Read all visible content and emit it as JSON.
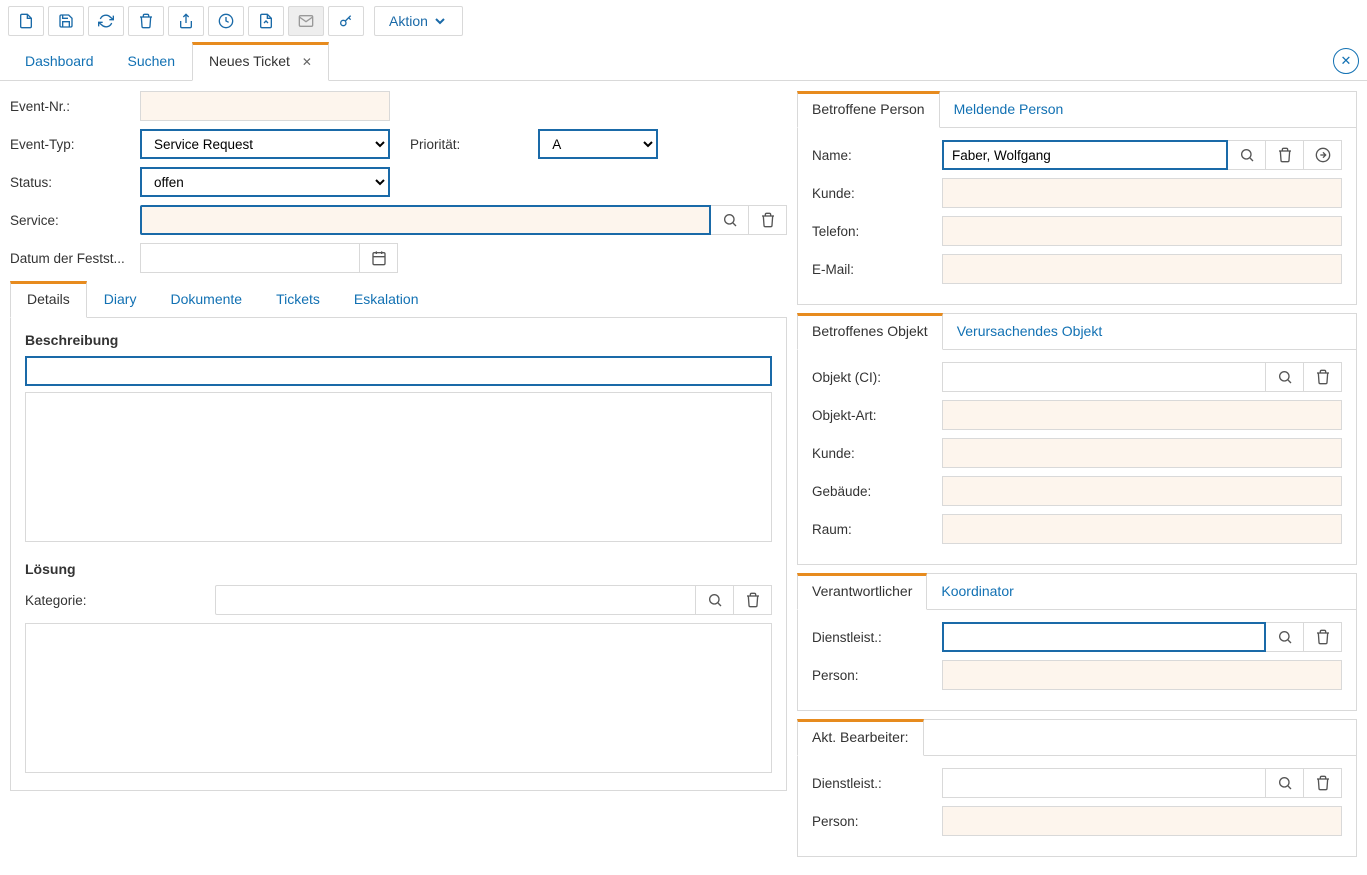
{
  "toolbar": {
    "action_label": "Aktion"
  },
  "main_tabs": {
    "items": [
      {
        "label": "Dashboard",
        "active": false,
        "closable": false
      },
      {
        "label": "Suchen",
        "active": false,
        "closable": false
      },
      {
        "label": "Neues Ticket",
        "active": true,
        "closable": true
      }
    ]
  },
  "form": {
    "event_nr_label": "Event-Nr.:",
    "event_nr_value": "",
    "event_type_label": "Event-Typ:",
    "event_type_value": "Service Request",
    "priority_label": "Priorität:",
    "priority_value": "A",
    "status_label": "Status:",
    "status_value": "offen",
    "service_label": "Service:",
    "service_value": "",
    "date_label": "Datum der Festst...",
    "date_value": ""
  },
  "detail_tabs": [
    "Details",
    "Diary",
    "Dokumente",
    "Tickets",
    "Eskalation"
  ],
  "details": {
    "description_heading": "Beschreibung",
    "description_title": "",
    "description_body": "",
    "solution_heading": "Lösung",
    "category_label": "Kategorie:",
    "category_value": "",
    "solution_body": ""
  },
  "person_panel": {
    "tabs": [
      "Betroffene Person",
      "Meldende Person"
    ],
    "name_label": "Name:",
    "name_value": "Faber, Wolfgang",
    "kunde_label": "Kunde:",
    "telefon_label": "Telefon:",
    "email_label": "E-Mail:"
  },
  "object_panel": {
    "tabs": [
      "Betroffenes Objekt",
      "Verursachendes Objekt"
    ],
    "ci_label": "Objekt (CI):",
    "art_label": "Objekt-Art:",
    "kunde_label": "Kunde:",
    "gebaeude_label": "Gebäude:",
    "raum_label": "Raum:"
  },
  "resp_panel": {
    "tabs": [
      "Verantwortlicher",
      "Koordinator"
    ],
    "dienst_label": "Dienstleist.:",
    "person_label": "Person:"
  },
  "akt_panel": {
    "title": "Akt. Bearbeiter:",
    "dienst_label": "Dienstleist.:",
    "person_label": "Person:"
  }
}
